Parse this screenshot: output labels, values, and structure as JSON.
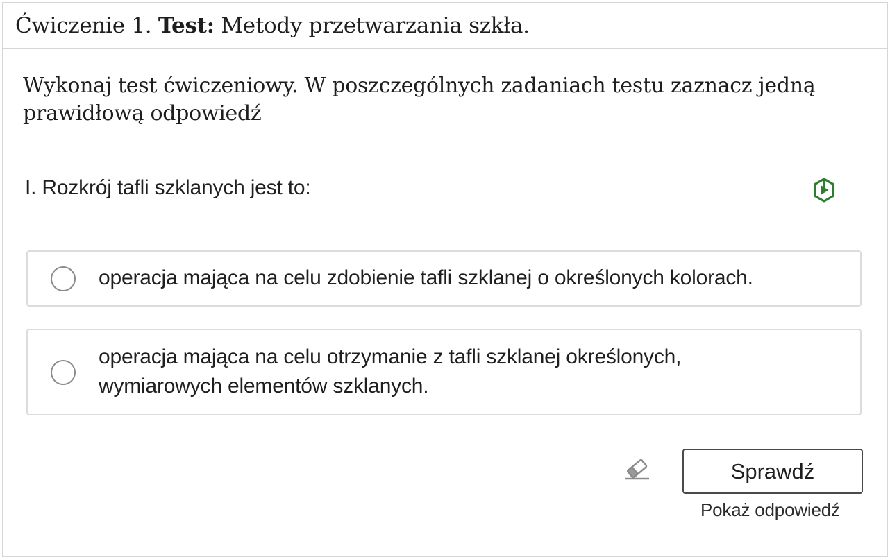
{
  "exercise": {
    "label": "Ćwiczenie 1.",
    "kind": "Test:",
    "title": "Metody przetwarzania szkła."
  },
  "instruction": "Wykonaj test ćwiczeniowy. W poszczególnych zadaniach testu zaznacz jedną prawidłową odpowiedź",
  "question": {
    "text": "I. Rozkrój tafli szklanych jest to:",
    "icon": "hexagon-play-icon",
    "icon_color": "#2e7d32"
  },
  "options": [
    {
      "text": "operacja mająca na celu zdobienie tafli szklanej o określonych kolorach.",
      "selected": false
    },
    {
      "text": "operacja mająca na celu otrzymanie z tafli szklanej określonych, wymiarowych elementów szklanych.",
      "selected": false
    }
  ],
  "actions": {
    "clear_icon": "eraser-icon",
    "check_label": "Sprawdź",
    "show_answer_label": "Pokaż odpowiedź"
  }
}
